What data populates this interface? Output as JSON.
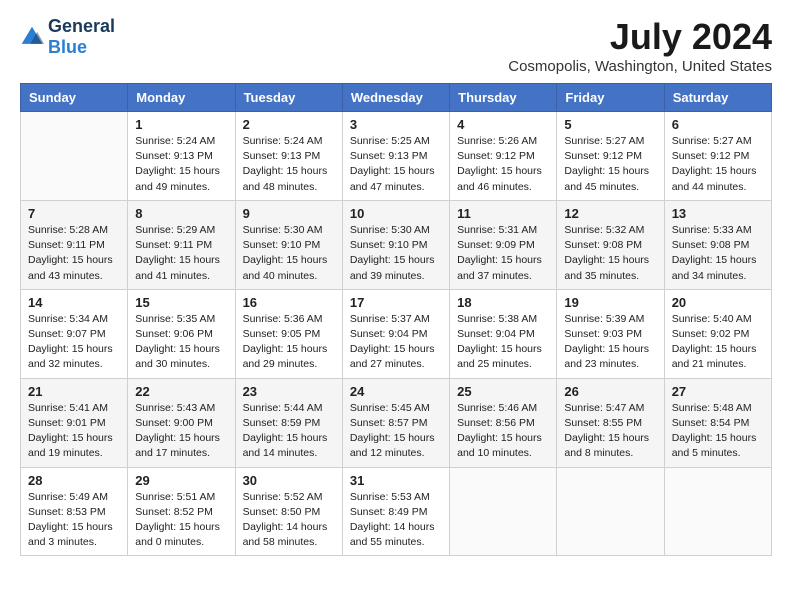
{
  "logo": {
    "general": "General",
    "blue": "Blue"
  },
  "title": "July 2024",
  "subtitle": "Cosmopolis, Washington, United States",
  "calendar": {
    "headers": [
      "Sunday",
      "Monday",
      "Tuesday",
      "Wednesday",
      "Thursday",
      "Friday",
      "Saturday"
    ],
    "weeks": [
      [
        {
          "day": "",
          "info": ""
        },
        {
          "day": "1",
          "info": "Sunrise: 5:24 AM\nSunset: 9:13 PM\nDaylight: 15 hours\nand 49 minutes."
        },
        {
          "day": "2",
          "info": "Sunrise: 5:24 AM\nSunset: 9:13 PM\nDaylight: 15 hours\nand 48 minutes."
        },
        {
          "day": "3",
          "info": "Sunrise: 5:25 AM\nSunset: 9:13 PM\nDaylight: 15 hours\nand 47 minutes."
        },
        {
          "day": "4",
          "info": "Sunrise: 5:26 AM\nSunset: 9:12 PM\nDaylight: 15 hours\nand 46 minutes."
        },
        {
          "day": "5",
          "info": "Sunrise: 5:27 AM\nSunset: 9:12 PM\nDaylight: 15 hours\nand 45 minutes."
        },
        {
          "day": "6",
          "info": "Sunrise: 5:27 AM\nSunset: 9:12 PM\nDaylight: 15 hours\nand 44 minutes."
        }
      ],
      [
        {
          "day": "7",
          "info": "Sunrise: 5:28 AM\nSunset: 9:11 PM\nDaylight: 15 hours\nand 43 minutes."
        },
        {
          "day": "8",
          "info": "Sunrise: 5:29 AM\nSunset: 9:11 PM\nDaylight: 15 hours\nand 41 minutes."
        },
        {
          "day": "9",
          "info": "Sunrise: 5:30 AM\nSunset: 9:10 PM\nDaylight: 15 hours\nand 40 minutes."
        },
        {
          "day": "10",
          "info": "Sunrise: 5:30 AM\nSunset: 9:10 PM\nDaylight: 15 hours\nand 39 minutes."
        },
        {
          "day": "11",
          "info": "Sunrise: 5:31 AM\nSunset: 9:09 PM\nDaylight: 15 hours\nand 37 minutes."
        },
        {
          "day": "12",
          "info": "Sunrise: 5:32 AM\nSunset: 9:08 PM\nDaylight: 15 hours\nand 35 minutes."
        },
        {
          "day": "13",
          "info": "Sunrise: 5:33 AM\nSunset: 9:08 PM\nDaylight: 15 hours\nand 34 minutes."
        }
      ],
      [
        {
          "day": "14",
          "info": "Sunrise: 5:34 AM\nSunset: 9:07 PM\nDaylight: 15 hours\nand 32 minutes."
        },
        {
          "day": "15",
          "info": "Sunrise: 5:35 AM\nSunset: 9:06 PM\nDaylight: 15 hours\nand 30 minutes."
        },
        {
          "day": "16",
          "info": "Sunrise: 5:36 AM\nSunset: 9:05 PM\nDaylight: 15 hours\nand 29 minutes."
        },
        {
          "day": "17",
          "info": "Sunrise: 5:37 AM\nSunset: 9:04 PM\nDaylight: 15 hours\nand 27 minutes."
        },
        {
          "day": "18",
          "info": "Sunrise: 5:38 AM\nSunset: 9:04 PM\nDaylight: 15 hours\nand 25 minutes."
        },
        {
          "day": "19",
          "info": "Sunrise: 5:39 AM\nSunset: 9:03 PM\nDaylight: 15 hours\nand 23 minutes."
        },
        {
          "day": "20",
          "info": "Sunrise: 5:40 AM\nSunset: 9:02 PM\nDaylight: 15 hours\nand 21 minutes."
        }
      ],
      [
        {
          "day": "21",
          "info": "Sunrise: 5:41 AM\nSunset: 9:01 PM\nDaylight: 15 hours\nand 19 minutes."
        },
        {
          "day": "22",
          "info": "Sunrise: 5:43 AM\nSunset: 9:00 PM\nDaylight: 15 hours\nand 17 minutes."
        },
        {
          "day": "23",
          "info": "Sunrise: 5:44 AM\nSunset: 8:59 PM\nDaylight: 15 hours\nand 14 minutes."
        },
        {
          "day": "24",
          "info": "Sunrise: 5:45 AM\nSunset: 8:57 PM\nDaylight: 15 hours\nand 12 minutes."
        },
        {
          "day": "25",
          "info": "Sunrise: 5:46 AM\nSunset: 8:56 PM\nDaylight: 15 hours\nand 10 minutes."
        },
        {
          "day": "26",
          "info": "Sunrise: 5:47 AM\nSunset: 8:55 PM\nDaylight: 15 hours\nand 8 minutes."
        },
        {
          "day": "27",
          "info": "Sunrise: 5:48 AM\nSunset: 8:54 PM\nDaylight: 15 hours\nand 5 minutes."
        }
      ],
      [
        {
          "day": "28",
          "info": "Sunrise: 5:49 AM\nSunset: 8:53 PM\nDaylight: 15 hours\nand 3 minutes."
        },
        {
          "day": "29",
          "info": "Sunrise: 5:51 AM\nSunset: 8:52 PM\nDaylight: 15 hours\nand 0 minutes."
        },
        {
          "day": "30",
          "info": "Sunrise: 5:52 AM\nSunset: 8:50 PM\nDaylight: 14 hours\nand 58 minutes."
        },
        {
          "day": "31",
          "info": "Sunrise: 5:53 AM\nSunset: 8:49 PM\nDaylight: 14 hours\nand 55 minutes."
        },
        {
          "day": "",
          "info": ""
        },
        {
          "day": "",
          "info": ""
        },
        {
          "day": "",
          "info": ""
        }
      ]
    ]
  }
}
